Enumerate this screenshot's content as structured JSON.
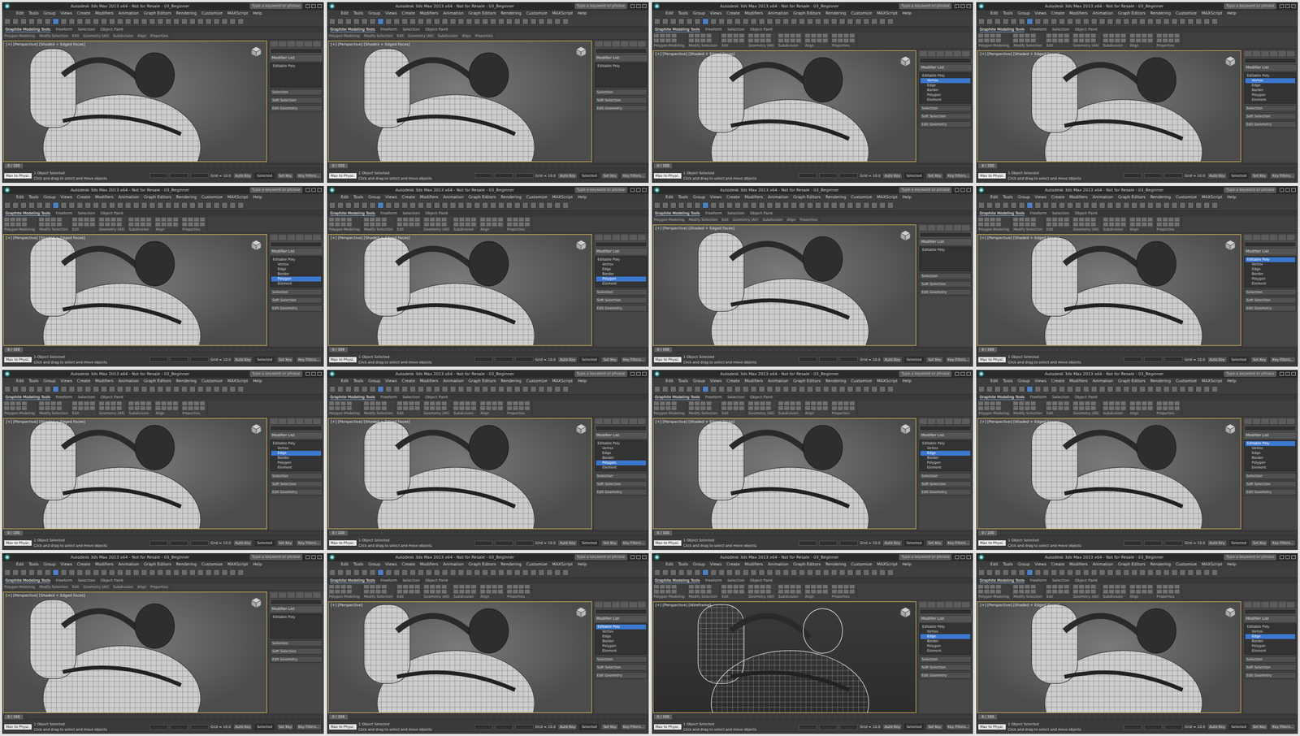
{
  "window": {
    "title": "Autodesk 3ds Max 2013 x64 - Not for Resale - 03_Beginner",
    "search_placeholder": "Type a keyword or phrase"
  },
  "menus": [
    "Edit",
    "Tools",
    "Group",
    "Views",
    "Create",
    "Modifiers",
    "Animation",
    "Graph Editors",
    "Rendering",
    "Customize",
    "MAXScript",
    "Help"
  ],
  "ribbon_tabs": [
    "Graphite Modeling Tools",
    "Freeform",
    "Selection",
    "Object Paint"
  ],
  "ribbon_groups": [
    "Polygon Modeling",
    "Modify Selection",
    "Edit",
    "Geometry (All)",
    "Subdivision",
    "Align",
    "Properties"
  ],
  "command_panel": {
    "modifier_list": "Modifier List",
    "levels": [
      "Editable Poly",
      "Vertex",
      "Edge",
      "Border",
      "Polygon",
      "Element"
    ],
    "rollouts": [
      "Selection",
      "Soft Selection",
      "Edit Geometry"
    ]
  },
  "timeline": "0 / 100",
  "status": {
    "script_box": "Max to Physc.",
    "selection": "1 Object Selected",
    "prompt": "Click and drag to select and move objects",
    "grid": "Grid = 10.0",
    "auto_key": "Auto Key",
    "key_mode": "Selected",
    "set_key": "Set Key",
    "key_filters": "Key Filters..."
  },
  "frames": [
    {
      "viewport_label": "[+] [Perspective] [Shaded + Edged Faces]",
      "ribbon_expanded": false,
      "stack_expanded": false,
      "selected_level": -1,
      "wireframe": false
    },
    {
      "viewport_label": "[+] [Perspective] [Shaded + Edged Faces]",
      "ribbon_expanded": false,
      "stack_expanded": false,
      "selected_level": -1,
      "wireframe": false
    },
    {
      "viewport_label": "[+] [Perspective] [Shaded + Edged Faces]",
      "ribbon_expanded": true,
      "stack_expanded": true,
      "selected_level": 1,
      "wireframe": false
    },
    {
      "viewport_label": "[+] [Perspective] [Shaded + Edged Faces]",
      "ribbon_expanded": true,
      "stack_expanded": true,
      "selected_level": 1,
      "wireframe": false
    },
    {
      "viewport_label": "[+] [Perspective] [Shaded + Edged Faces]",
      "ribbon_expanded": true,
      "stack_expanded": true,
      "selected_level": 4,
      "wireframe": false
    },
    {
      "viewport_label": "[+] [Perspective] [Shaded + Edged Faces]",
      "ribbon_expanded": true,
      "stack_expanded": true,
      "selected_level": 4,
      "wireframe": false
    },
    {
      "viewport_label": "[+] [Perspective] [Shaded + Edged Faces]",
      "ribbon_expanded": false,
      "stack_expanded": false,
      "selected_level": -1,
      "wireframe": false
    },
    {
      "viewport_label": "[+] [Perspective] [Shaded + Edged Faces]",
      "ribbon_expanded": true,
      "stack_expanded": true,
      "selected_level": 0,
      "wireframe": false
    },
    {
      "viewport_label": "[+] [Perspective] [Shaded + Edged Faces]",
      "ribbon_expanded": true,
      "stack_expanded": true,
      "selected_level": 2,
      "wireframe": false
    },
    {
      "viewport_label": "[+] [Perspective] [Shaded + Edged Faces]",
      "ribbon_expanded": true,
      "stack_expanded": true,
      "selected_level": 4,
      "wireframe": false
    },
    {
      "viewport_label": "[+] [Perspective] [Shaded + Edged Faces]",
      "ribbon_expanded": true,
      "stack_expanded": true,
      "selected_level": 2,
      "wireframe": false
    },
    {
      "viewport_label": "[+] [Perspective] [Shaded + Edged Faces]",
      "ribbon_expanded": true,
      "stack_expanded": true,
      "selected_level": 0,
      "wireframe": false
    },
    {
      "viewport_label": "[+] [Perspective] [Shaded + Edged Faces]",
      "ribbon_expanded": false,
      "stack_expanded": false,
      "selected_level": -1,
      "wireframe": false
    },
    {
      "viewport_label": "[+] [Perspective]",
      "ribbon_expanded": true,
      "stack_expanded": true,
      "selected_level": 0,
      "wireframe": false
    },
    {
      "viewport_label": "[+] [Perspective] [Wireframe]",
      "ribbon_expanded": true,
      "stack_expanded": true,
      "selected_level": 2,
      "wireframe": true
    },
    {
      "viewport_label": "[+] [Perspective] [Shaded + Edged Faces]",
      "ribbon_expanded": true,
      "stack_expanded": true,
      "selected_level": 2,
      "wireframe": false
    }
  ]
}
